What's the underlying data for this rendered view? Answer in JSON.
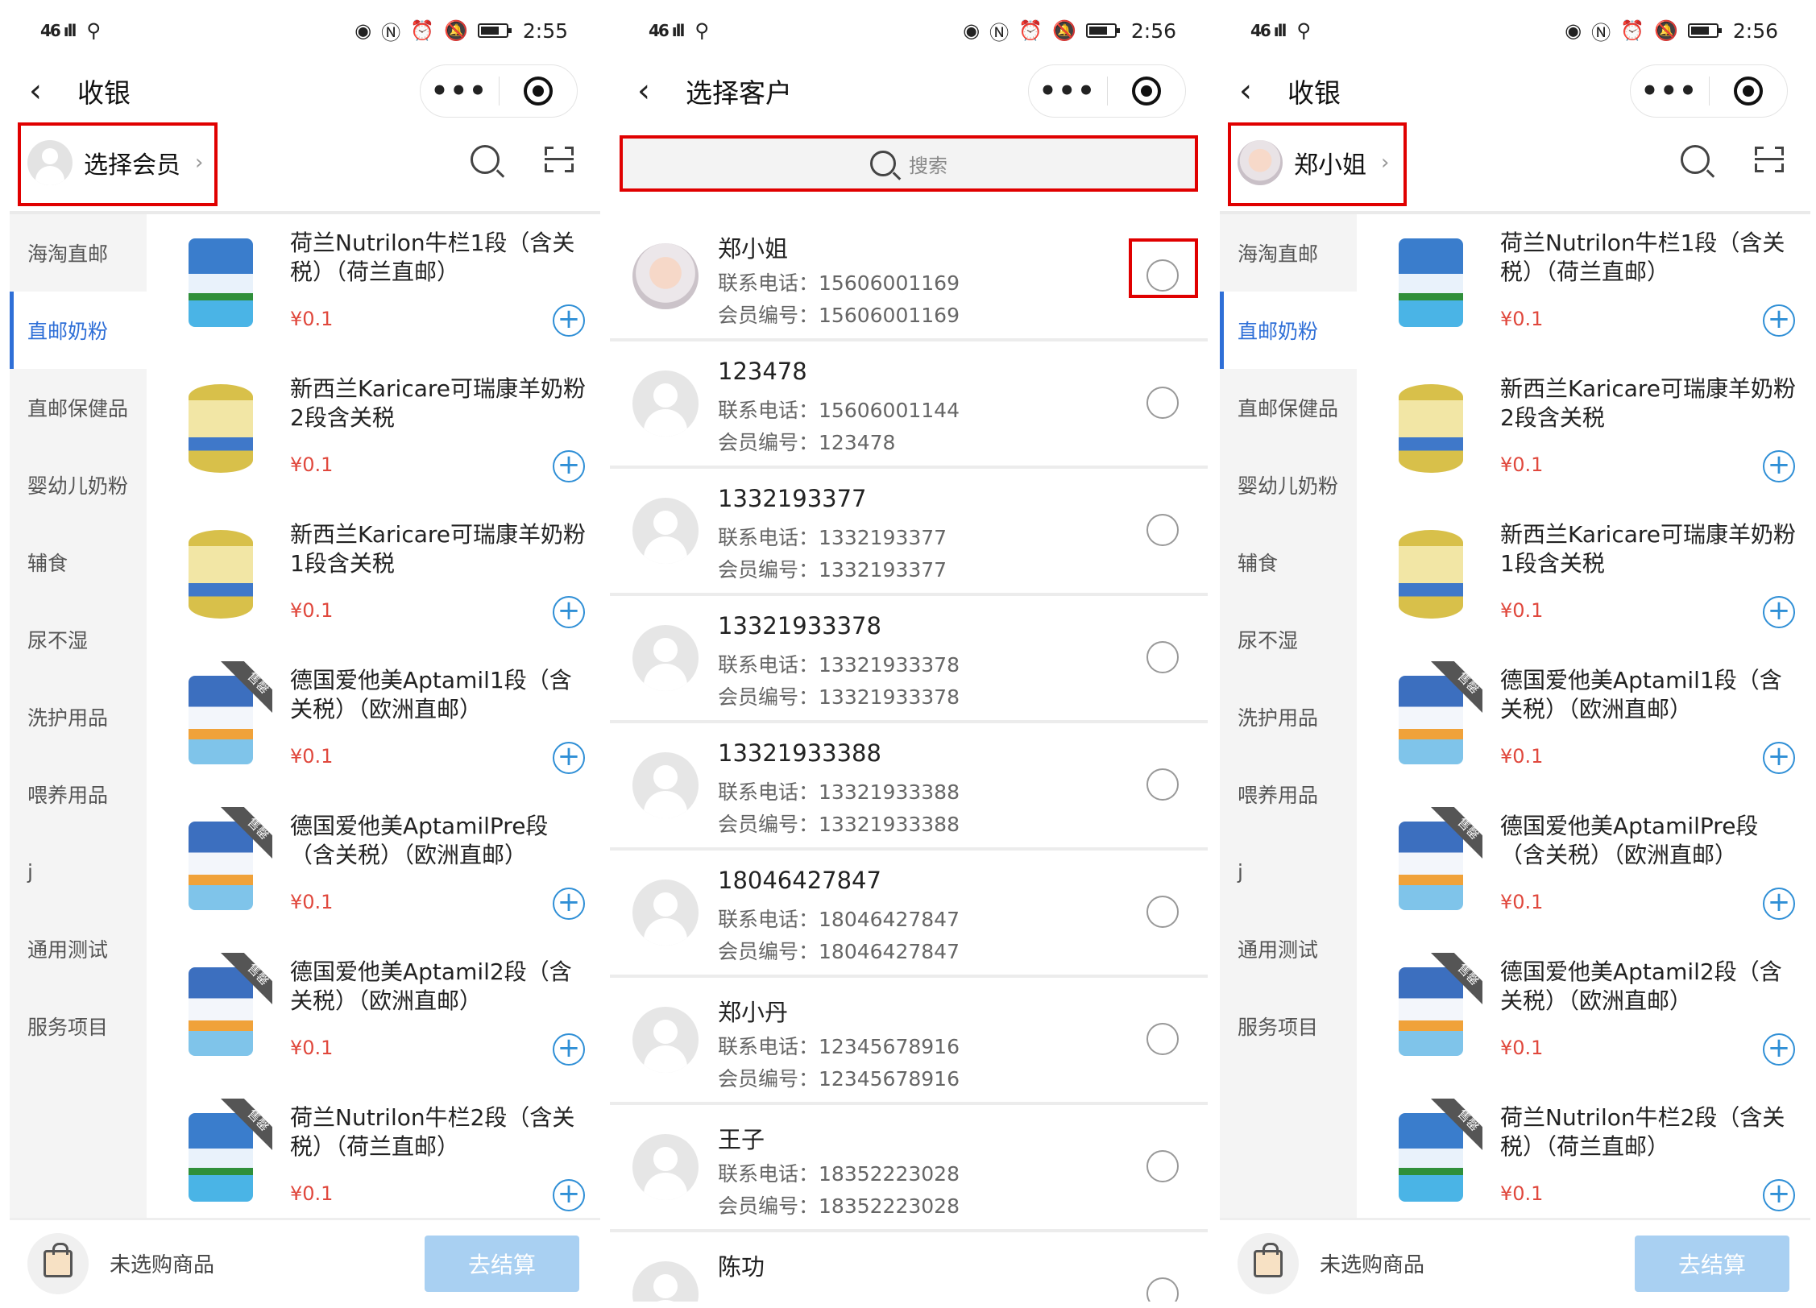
{
  "status_bars": [
    {
      "left": "46 ıll",
      "time": "2:55"
    },
    {
      "left": "46 ıll",
      "time": "2:56"
    },
    {
      "left": "46 ıll",
      "time": "2:56"
    }
  ],
  "screens": {
    "cashier1": {
      "title": "收银",
      "member": {
        "label": "选择会员"
      }
    },
    "customer": {
      "title": "选择客户",
      "search_placeholder": "搜索"
    },
    "cashier2": {
      "title": "收银",
      "member": {
        "label": "郑小姐"
      }
    }
  },
  "categories": [
    "海淘直邮",
    "直邮奶粉",
    "直邮保健品",
    "婴幼儿奶粉",
    "辅食",
    "尿不湿",
    "洗护用品",
    "喂养用品",
    "j",
    "通用测试",
    "服务项目"
  ],
  "active_category": "直邮奶粉",
  "products": [
    {
      "name": "荷兰Nutrilon牛栏1段（含关税）（荷兰直邮）",
      "price": "¥0.1",
      "thumb": "nutrilon",
      "ribbon": ""
    },
    {
      "name": "新西兰Karicare可瑞康羊奶粉2段含关税",
      "price": "¥0.1",
      "thumb": "karicare",
      "ribbon": ""
    },
    {
      "name": "新西兰Karicare可瑞康羊奶粉1段含关税",
      "price": "¥0.1",
      "thumb": "karicare",
      "ribbon": ""
    },
    {
      "name": "德国爱他美Aptamil1段（含关税）（欧洲直邮）",
      "price": "¥0.1",
      "thumb": "aptamil",
      "ribbon": "售罄"
    },
    {
      "name": "德国爱他美AptamilPre段（含关税）（欧洲直邮）",
      "price": "¥0.1",
      "thumb": "aptamil",
      "ribbon": "售罄"
    },
    {
      "name": "德国爱他美Aptamil2段（含关税）（欧洲直邮）",
      "price": "¥0.1",
      "thumb": "aptamil",
      "ribbon": "售罄"
    },
    {
      "name": "荷兰Nutrilon牛栏2段（含关税）（荷兰直邮）",
      "price": "¥0.1",
      "thumb": "nutrilon",
      "ribbon": "售罄"
    }
  ],
  "footer": {
    "cart_text": "未选购商品",
    "checkout": "去结算"
  },
  "customers": [
    {
      "name": "郑小姐",
      "phone_label": "联系电话：",
      "phone": "15606001169",
      "id_label": "会员编号：",
      "id": "15606001169",
      "photo": true
    },
    {
      "name": "123478",
      "phone_label": "联系电话：",
      "phone": "15606001144",
      "id_label": "会员编号：",
      "id": "123478"
    },
    {
      "name": "1332193377",
      "phone_label": "联系电话：",
      "phone": "1332193377",
      "id_label": "会员编号：",
      "id": "1332193377"
    },
    {
      "name": "13321933378",
      "phone_label": "联系电话：",
      "phone": "13321933378",
      "id_label": "会员编号：",
      "id": "13321933378"
    },
    {
      "name": "13321933388",
      "phone_label": "联系电话：",
      "phone": "13321933388",
      "id_label": "会员编号：",
      "id": "13321933388"
    },
    {
      "name": "18046427847",
      "phone_label": "联系电话：",
      "phone": "18046427847",
      "id_label": "会员编号：",
      "id": "18046427847"
    },
    {
      "name": "郑小丹",
      "phone_label": "联系电话：",
      "phone": "12345678916",
      "id_label": "会员编号：",
      "id": "12345678916"
    },
    {
      "name": "王子",
      "phone_label": "联系电话：",
      "phone": "18352223028",
      "id_label": "会员编号：",
      "id": "18352223028"
    },
    {
      "name": "陈功",
      "phone_label": "",
      "phone": "",
      "id_label": "",
      "id": ""
    }
  ],
  "colors": {
    "accent": "#2f6fd7",
    "price": "#e0483d",
    "highlight": "#e00000",
    "checkout": "#a9d0f2"
  }
}
